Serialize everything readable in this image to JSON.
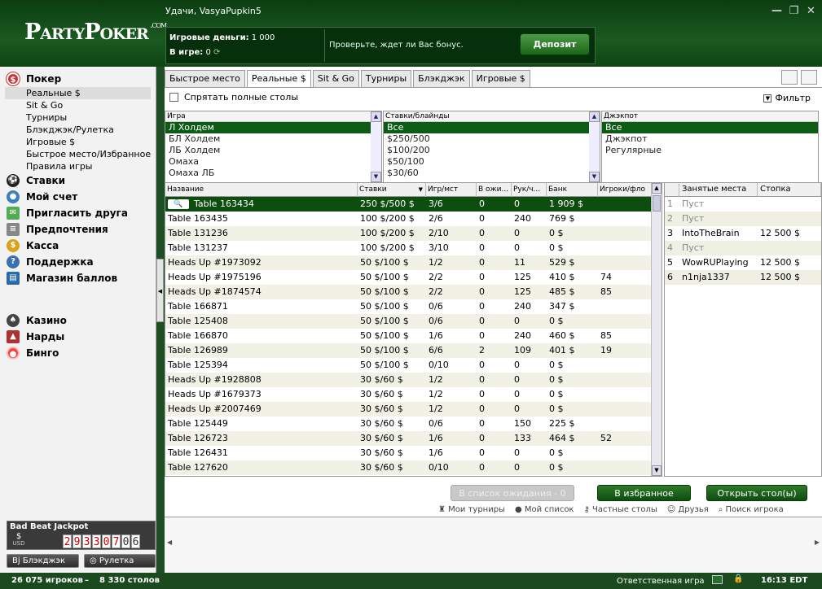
{
  "header": {
    "logo": "PartyPoker",
    "logo_suffix": ".com",
    "greeting": "Удачи, VasyaPupkin5",
    "play_money_label": "Игровые деньги:",
    "play_money_value": "1 000",
    "in_game_label": "В игре:",
    "in_game_value": "0",
    "bonus_text": "Проверьте, ждет ли Вас бонус.",
    "deposit_label": "Депозит"
  },
  "sidebar": {
    "poker": "Покер",
    "sub": [
      "Реальные $",
      "Sit & Go",
      "Турниры",
      "Блэкджэк/Рулетка",
      "Игровые $",
      "Быстрое место/Избранное",
      "Правила игры"
    ],
    "sections": [
      "Ставки",
      "Мой счет",
      "Пригласить друга",
      "Предпочтения",
      "Касса",
      "Поддержка",
      "Магазин баллов"
    ],
    "games": [
      "Казино",
      "Нарды",
      "Бинго"
    ],
    "jackpot_title": "Bad Beat Jackpot",
    "jackpot_currency": "USD",
    "jackpot_digits": [
      "2",
      "9",
      "3",
      "3",
      "0",
      "7",
      "0",
      "6"
    ],
    "blackjack_btn": "Блэкджэк",
    "roulette_btn": "Рулетка"
  },
  "tabs": [
    "Быстрое место",
    "Реальные $",
    "Sit & Go",
    "Турниры",
    "Блэкджэк",
    "Игровые $"
  ],
  "hide_full_label": "Спрятать полные столы",
  "filter_label": "Фильтр",
  "filters": {
    "game": {
      "title": "Игра",
      "options": [
        "Л Холдем",
        "БЛ Холдем",
        "ЛБ Холдем",
        "Омаха",
        "Омаха ЛБ"
      ]
    },
    "stakes": {
      "title": "Ставки/блайнды",
      "options": [
        "Все",
        "$250/500",
        "$100/200",
        "$50/100",
        "$30/60"
      ]
    },
    "jackpot": {
      "title": "Джэкпот",
      "options": [
        "Все",
        "Джэкпот",
        "Регулярные"
      ]
    }
  },
  "table": {
    "headers": [
      "Название",
      "Ставки",
      "Игр/мст",
      "В ожи...",
      "Рук/ч...",
      "Банк",
      "Игроки/фло"
    ],
    "rows": [
      [
        "Table  163434",
        "250 $/500 $",
        "3/6",
        "0",
        "0",
        "1 909 $",
        ""
      ],
      [
        "Table  163435",
        "100 $/200 $",
        "2/6",
        "0",
        "240",
        "769 $",
        ""
      ],
      [
        "Table  131236",
        "100 $/200 $",
        "2/10",
        "0",
        "0",
        "0 $",
        ""
      ],
      [
        "Table  131237",
        "100 $/200 $",
        "3/10",
        "0",
        "0",
        "0 $",
        ""
      ],
      [
        "Heads Up #1973092",
        "50 $/100 $",
        "1/2",
        "0",
        "11",
        "529 $",
        ""
      ],
      [
        "Heads Up #1975196",
        "50 $/100 $",
        "2/2",
        "0",
        "125",
        "410 $",
        "74"
      ],
      [
        "Heads Up #1874574",
        "50 $/100 $",
        "2/2",
        "0",
        "125",
        "485 $",
        "85"
      ],
      [
        "Table  166871",
        "50 $/100 $",
        "0/6",
        "0",
        "240",
        "347 $",
        ""
      ],
      [
        "Table  125408",
        "50 $/100 $",
        "0/6",
        "0",
        "0",
        "0 $",
        ""
      ],
      [
        "Table  166870",
        "50 $/100 $",
        "1/6",
        "0",
        "240",
        "460 $",
        "85"
      ],
      [
        "Table  126989",
        "50 $/100 $",
        "6/6",
        "2",
        "109",
        "401 $",
        "19"
      ],
      [
        "Table  125394",
        "50 $/100 $",
        "0/10",
        "0",
        "0",
        "0 $",
        ""
      ],
      [
        "Heads Up #1928808",
        "30 $/60 $",
        "1/2",
        "0",
        "0",
        "0 $",
        ""
      ],
      [
        "Heads Up #1679373",
        "30 $/60 $",
        "1/2",
        "0",
        "0",
        "0 $",
        ""
      ],
      [
        "Heads Up #2007469",
        "30 $/60 $",
        "1/2",
        "0",
        "0",
        "0 $",
        ""
      ],
      [
        "Table  125449",
        "30 $/60 $",
        "0/6",
        "0",
        "150",
        "225 $",
        ""
      ],
      [
        "Table  126723",
        "30 $/60 $",
        "1/6",
        "0",
        "133",
        "464 $",
        "52"
      ],
      [
        "Table  126431",
        "30 $/60 $",
        "1/6",
        "0",
        "0",
        "0 $",
        ""
      ],
      [
        "Table  127620",
        "30 $/60 $",
        "0/10",
        "0",
        "0",
        "0 $",
        ""
      ]
    ]
  },
  "seats": {
    "headers": [
      "Занятые места",
      "Стопка"
    ],
    "rows": [
      [
        "1",
        "Пуст",
        ""
      ],
      [
        "2",
        "Пуст",
        ""
      ],
      [
        "3",
        "IntoTheBrain",
        "12 500 $"
      ],
      [
        "4",
        "Пуст",
        ""
      ],
      [
        "5",
        "WowRUPlaying",
        "12 500 $"
      ],
      [
        "6",
        "n1nja1337",
        "12 500 $"
      ]
    ]
  },
  "buttons": {
    "waitlist": "В список ожидания - 0",
    "favorites": "В избранное",
    "open_table": "Открыть стол(ы)"
  },
  "links": [
    "Мои турниры",
    "Мой список",
    "Частные столы",
    "Друзья",
    "Поиск игрока"
  ],
  "status": {
    "players": "26 075 игроков",
    "tables": "8 330 столов",
    "responsible": "Ответственная игра",
    "time": "16:13 EDT"
  },
  "colors": {
    "brand_green": "#0d4d0f",
    "jackpot_red": "#cc0000"
  }
}
